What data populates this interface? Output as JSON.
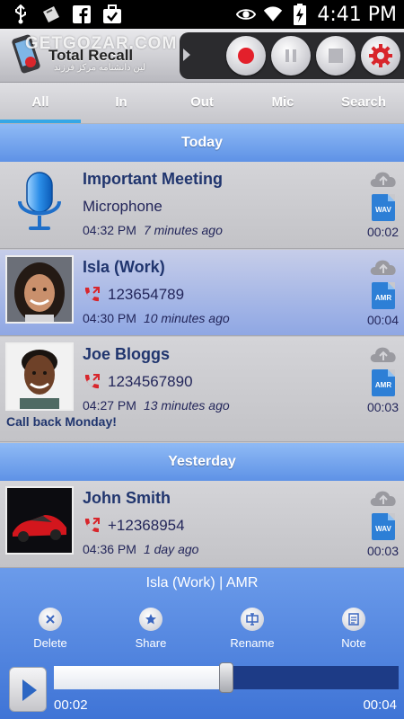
{
  "status_bar": {
    "time": "4:41 PM",
    "left_icons": [
      "usb-icon",
      "bag-icon",
      "facebook-icon",
      "briefcase-check-icon"
    ],
    "right_icons": [
      "eye-icon",
      "wifi-icon",
      "battery-charging-icon"
    ]
  },
  "header": {
    "app_name": "Total Recall",
    "watermark": "GETGOZAR.COM",
    "watermark_sub": "لین دانشنامه مرکز فرزند"
  },
  "tabs": [
    {
      "label": "All",
      "active": true
    },
    {
      "label": "In",
      "active": false
    },
    {
      "label": "Out",
      "active": false
    },
    {
      "label": "Mic",
      "active": false
    },
    {
      "label": "Search",
      "active": false
    }
  ],
  "sections": {
    "today": "Today",
    "yesterday": "Yesterday"
  },
  "records": [
    {
      "name": "Important Meeting",
      "detail": "Microphone",
      "time": "04:32 PM",
      "ago": "7 minutes ago",
      "format": "WAV",
      "duration": "00:02",
      "note": "",
      "kind": "mic"
    },
    {
      "name": "Isla (Work)",
      "detail": "123654789",
      "time": "04:30 PM",
      "ago": "10 minutes ago",
      "format": "AMR",
      "duration": "00:04",
      "note": "",
      "kind": "call"
    },
    {
      "name": "Joe Bloggs",
      "detail": "1234567890",
      "time": "04:27 PM",
      "ago": "13 minutes ago",
      "format": "AMR",
      "duration": "00:03",
      "note": "Call back Monday!",
      "kind": "call"
    },
    {
      "name": "John Smith",
      "detail": "+12368954",
      "time": "04:36 PM",
      "ago": "1 day ago",
      "format": "WAV",
      "duration": "00:03",
      "note": "",
      "kind": "call"
    }
  ],
  "player": {
    "title": "Isla (Work) | AMR",
    "actions": [
      "Delete",
      "Share",
      "Rename",
      "Note"
    ],
    "current": "00:02",
    "total": "00:04",
    "progress": 0.5
  },
  "colors": {
    "accent": "#35a7e6",
    "section_blue": "#6f9ded",
    "selected_row": "#a8b9e8",
    "text_dark": "#20356e",
    "record_red": "#e3202b"
  }
}
